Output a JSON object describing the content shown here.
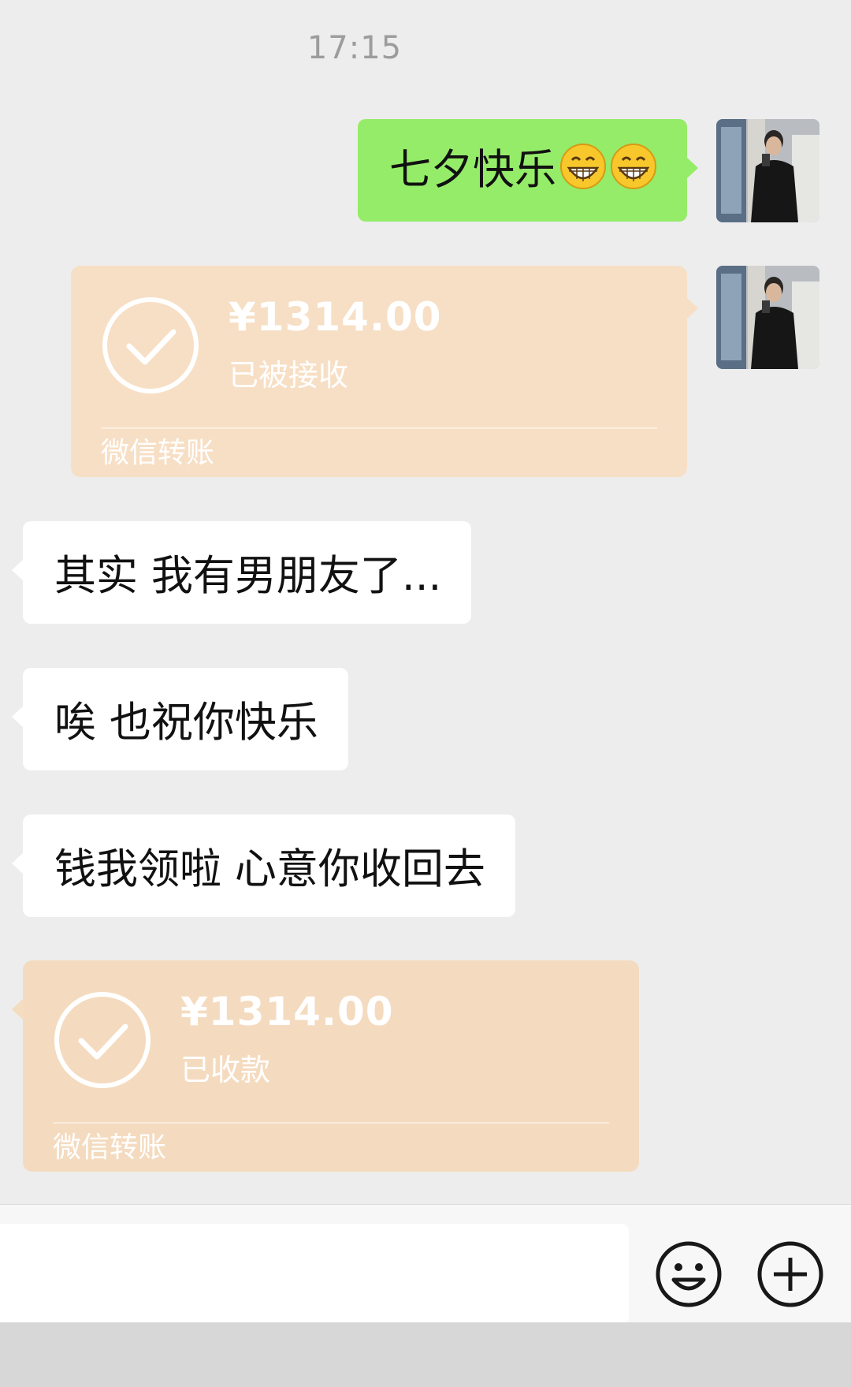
{
  "chat": {
    "timestamp": "17:15",
    "messages": [
      {
        "sender": "me",
        "type": "text",
        "text": "七夕快乐",
        "emojis": [
          "grin-emoji",
          "grin-emoji"
        ]
      },
      {
        "sender": "me",
        "type": "transfer",
        "amount": "¥1314.00",
        "status": "已被接收",
        "brand": "微信转账"
      },
      {
        "sender": "other",
        "type": "text",
        "text": "其实 我有男朋友了..."
      },
      {
        "sender": "other",
        "type": "text",
        "text": "唉 也祝你快乐"
      },
      {
        "sender": "other",
        "type": "text",
        "text": "钱我领啦 心意你收回去"
      },
      {
        "sender": "other",
        "type": "transfer",
        "amount": "¥1314.00",
        "status": "已收款",
        "brand": "微信转账"
      }
    ]
  },
  "input_bar": {
    "value": "",
    "icons": [
      "emoji-icon",
      "plus-icon"
    ]
  },
  "colors": {
    "background": "#ededed",
    "outgoing_bubble": "#95ec69",
    "incoming_bubble": "#ffffff",
    "transfer_card": "#f7dfc5",
    "timestamp": "#9c9c9c"
  }
}
